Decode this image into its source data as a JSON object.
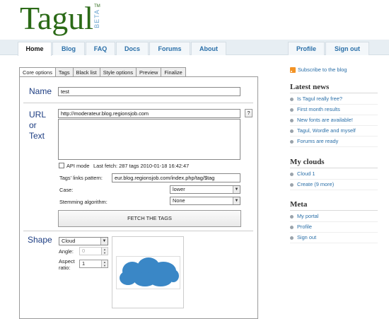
{
  "logo": {
    "name": "Tagul",
    "tm": "TM",
    "beta": "BETA"
  },
  "nav": {
    "left": [
      "Home",
      "Blog",
      "FAQ",
      "Docs",
      "Forums",
      "About"
    ],
    "right": [
      "Profile",
      "Sign out"
    ],
    "active": "Home"
  },
  "tabs": [
    "Core options",
    "Tags",
    "Black list",
    "Style options",
    "Preview",
    "Finalize"
  ],
  "core": {
    "name_label": "Name",
    "name_value": "test",
    "url_label_1": "URL",
    "url_label_2": "or",
    "url_label_3": "Text",
    "url_value": "http://moderateur.blog.regionsjob.com",
    "help_button": "?",
    "api_mode_label": "API mode",
    "last_fetch": "Last fetch: 287 tags 2010-01-18 16:42:47",
    "links_pattern_label": "Tags' links pattern:",
    "links_pattern_value": "eur.blog.regionsjob.com/index.php/tag/$tag",
    "case_label": "Case:",
    "case_value": "lower",
    "stemming_label": "Stemming algorithm:",
    "stemming_value": "None",
    "fetch_button": "FETCH THE TAGS"
  },
  "shape": {
    "label": "Shape",
    "shape_value": "Cloud",
    "angle_label": "Angle:",
    "angle_value": "0",
    "aspect_label_1": "Aspect",
    "aspect_label_2": "ratio:",
    "aspect_value": "1",
    "shape_color": "#3a87c6"
  },
  "sidebar": {
    "subscribe": "Subscribe to the blog",
    "latest_news_title": "Latest news",
    "latest_news": [
      "Is Tagul really free?",
      "First month results",
      "New fonts are available!",
      "Tagul, Wordle and myself",
      "Forums are ready"
    ],
    "my_clouds_title": "My clouds",
    "my_clouds": [
      "Cloud 1",
      "Create (9 more)"
    ],
    "meta_title": "Meta",
    "meta": [
      "My portal",
      "Profile",
      "Sign out"
    ]
  }
}
